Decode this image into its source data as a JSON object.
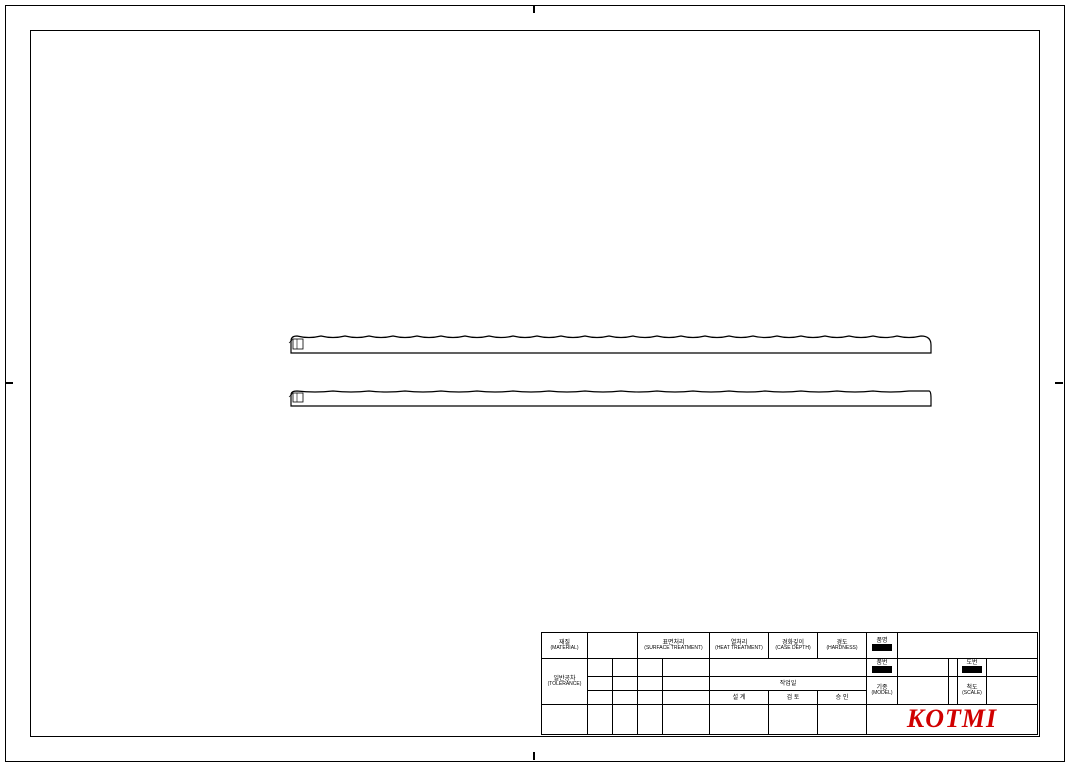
{
  "titleblock": {
    "row1": {
      "c1_kr": "재질",
      "c1_en": "(MATERIAL)",
      "c2_kr": "표면처리",
      "c2_en": "(SURFACE TREATMENT)",
      "c3_kr": "열처리",
      "c3_en": "(HEAT TREATMENT)",
      "c4_kr": "경화깊이",
      "c4_en": "(CASE DEPTH)",
      "c5_kr": "경도",
      "c5_en": "(HARDNESS)",
      "c6_kr": "품명"
    },
    "row2": {
      "tol_kr": "일반공차",
      "tol_en": "(TOLERANCE)",
      "work_kr": "작업일",
      "wb_kr": "품번",
      "dn_kr": "도번"
    },
    "row3": {
      "c1": "설 계",
      "c2": "검 토",
      "c3": "승 인",
      "model_kr": "기종",
      "model_en": "(MODEL)",
      "scale_kr": "척도",
      "scale_en": "(SCALE)"
    },
    "logo": "KOTMI"
  },
  "drawing": {
    "views": 2,
    "description": "Two elongated horizontal profile views with scalloped top edges and a small rectangular feature at the left end."
  }
}
